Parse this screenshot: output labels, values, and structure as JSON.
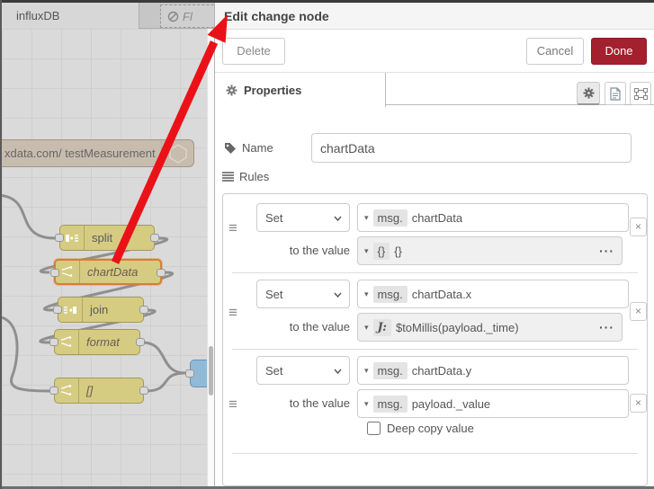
{
  "workspace": {
    "tabs": [
      {
        "label": "influxDB",
        "state": "active"
      },
      {
        "label": "Fl",
        "state": "disabled"
      }
    ],
    "nodes": {
      "influx": {
        "label": "xdata.com/ testMeasurement"
      },
      "split": {
        "label": "split"
      },
      "chartData": {
        "label": "chartData",
        "selected": true
      },
      "join": {
        "label": "join"
      },
      "format": {
        "label": "format"
      },
      "brackets": {
        "label": "[]"
      }
    }
  },
  "tray": {
    "title": "Edit change node",
    "buttons": {
      "delete": "Delete",
      "cancel": "Cancel",
      "done": "Done"
    },
    "tab": {
      "label": "Properties"
    },
    "name": {
      "label": "Name",
      "value": "chartData"
    },
    "rules_label": "Rules",
    "to_the_value": "to the value",
    "deep_copy_label": "Deep copy value",
    "deep_copy_checked": false,
    "rules": [
      {
        "action": "Set",
        "property_type": "msg.",
        "property": "chartData",
        "value_type": "{}",
        "value": "{}"
      },
      {
        "action": "Set",
        "property_type": "msg.",
        "property": "chartData.x",
        "value_type": "J:",
        "value": "$toMillis(payload._time)"
      },
      {
        "action": "Set",
        "property_type": "msg.",
        "property": "chartData.y",
        "value_type": "msg.",
        "value": "payload._value"
      }
    ]
  },
  "glyphs": {
    "caret": "▾",
    "chevron": "▾",
    "drag": "≡",
    "close": "×",
    "ellipsis": "···"
  },
  "colors": {
    "done_button": "#A3202E",
    "node_yellow": "#D5CC82",
    "node_selected_border": "#D77F33",
    "node_influx": "#C8BCAE",
    "node_blue": "#8FBBD9",
    "annotation_arrow": "#EA1218"
  }
}
